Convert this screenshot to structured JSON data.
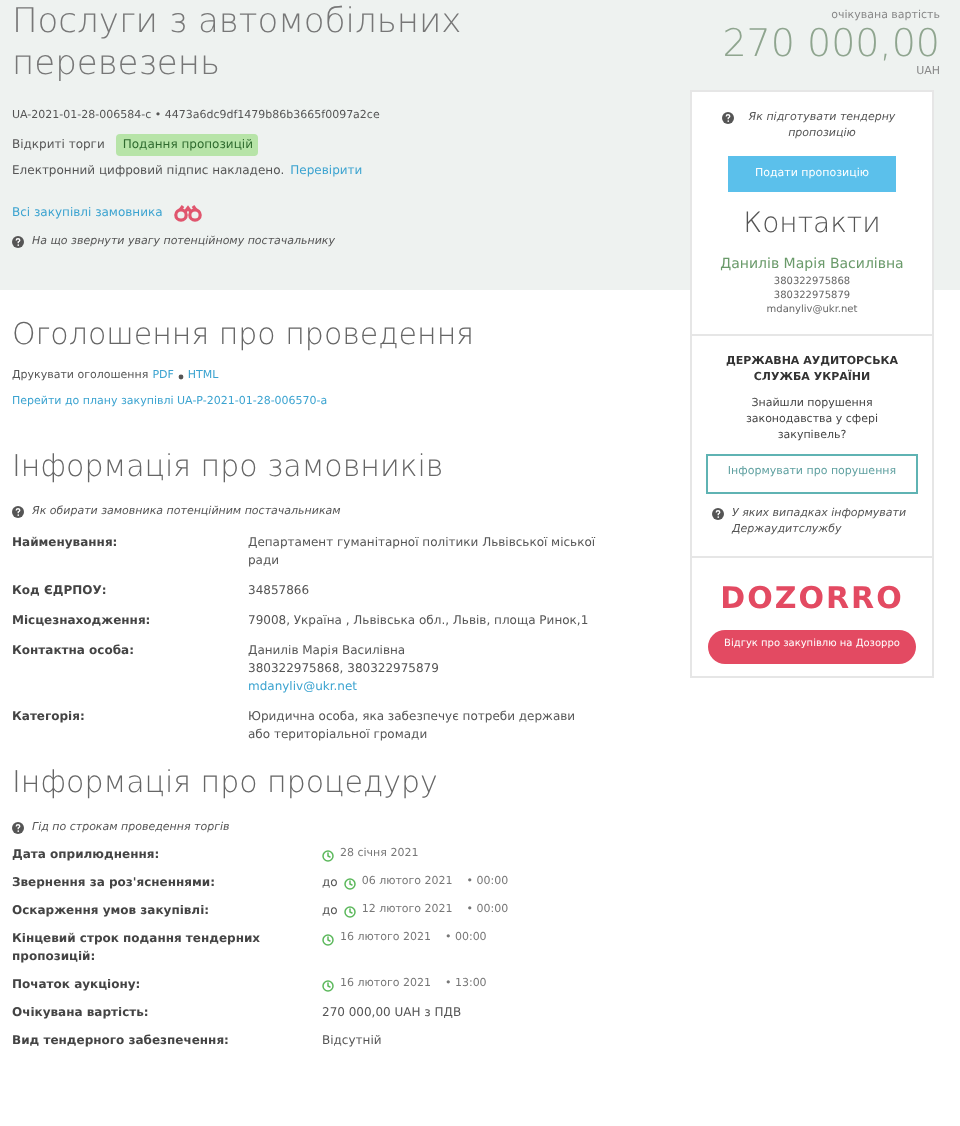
{
  "title": "Послуги з автомобільних перевезень",
  "tender_id": "UA-2021-01-28-006584-c • 4473a6dc9df1479b86b3665f0097a2ce",
  "procedure_type": "Відкриті торги",
  "status_badge": "Подання пропозицій",
  "signature": {
    "text": "Електронний цифровий підпис накладено.",
    "link": "Перевірити"
  },
  "all_purchases_link": "Всі закупівлі замовника",
  "supplier_hint": "На що звернути увагу потенційному постачальнику",
  "price": {
    "caption": "очікувана вартість",
    "amount": "270 000,00",
    "currency": "UAH"
  },
  "sidebar": {
    "proposal_hint": "Як підготувати тендерну пропозицію",
    "submit_button": "Подати пропозицію",
    "contacts_title": "Контакти",
    "contact_name": "Данилів Марія Василівна",
    "contact_lines": [
      "380322975868",
      "380322975879",
      "mdanyliv@ukr.net"
    ],
    "audit_title": "ДЕРЖАВНА АУДИТОРСЬКА СЛУЖБА УКРАЇНИ",
    "audit_question": "Знайшли порушення законодавства у сфері закупівель?",
    "audit_button": "Інформувати про порушення",
    "audit_hint": "У яких випадках інформувати Держаудитслужбу",
    "dozorro_logo": "DOZORRO",
    "dozorro_button": "Відгук про закупівлю на Дозорро"
  },
  "announcement": {
    "heading": "Оголошення про проведення",
    "print_label": "Друкувати оголошення",
    "print_links": [
      "PDF",
      "HTML"
    ],
    "plan_link": "Перейти до плану закупівлі UA-P-2021-01-28-006570-a"
  },
  "customers": {
    "heading": "Інформація про замовників",
    "hint": "Як обирати замовника потенційним постачальникам",
    "rows": [
      {
        "label": "Найменування:",
        "lines": [
          {
            "kind": "text",
            "text": "Департамент гуманітарної політики Львівської міської ради"
          }
        ]
      },
      {
        "label": "Код ЄДРПОУ:",
        "lines": [
          {
            "kind": "text",
            "text": "34857866"
          }
        ]
      },
      {
        "label": "Місцезнаходження:",
        "lines": [
          {
            "kind": "text",
            "text": "79008, Україна , Львівська обл., Львів, площа Ринок,1"
          }
        ]
      },
      {
        "label": "Контактна особа:",
        "lines": [
          {
            "kind": "text",
            "text": "Данилів Марія Василівна"
          },
          {
            "kind": "text",
            "text": "380322975868, 380322975879"
          },
          {
            "kind": "link",
            "text": "mdanyliv@ukr.net"
          }
        ]
      },
      {
        "label": "Категорія:",
        "lines": [
          {
            "kind": "text",
            "text": "Юридична особа, яка забезпечує потреби держави або територіальної громади"
          }
        ]
      }
    ]
  },
  "procedure": {
    "heading": "Інформація про процедуру",
    "hint": "Гід по строкам проведення торгів",
    "rows": [
      {
        "label": "Дата оприлюднення:",
        "kind": "date",
        "date": "28 січня 2021"
      },
      {
        "label": "Звернення за роз'ясненнями:",
        "kind": "date",
        "prefix": "до",
        "date": "06 лютого 2021",
        "time": "• 00:00"
      },
      {
        "label": "Оскарження умов закупівлі:",
        "kind": "date",
        "prefix": "до",
        "date": "12 лютого 2021",
        "time": "• 00:00"
      },
      {
        "label": "Кінцевий строк подання тендерних пропозицій:",
        "kind": "date",
        "date": "16 лютого 2021",
        "time": "• 00:00"
      },
      {
        "label": "Початок аукціону:",
        "kind": "date",
        "date": "16 лютого 2021",
        "time": "• 13:00"
      },
      {
        "label": "Очікувана вартість:",
        "kind": "text",
        "value": "270 000,00 UAH з ПДВ"
      },
      {
        "label": "Вид тендерного забезпечення:",
        "kind": "text",
        "value": "Відсутній"
      }
    ]
  }
}
